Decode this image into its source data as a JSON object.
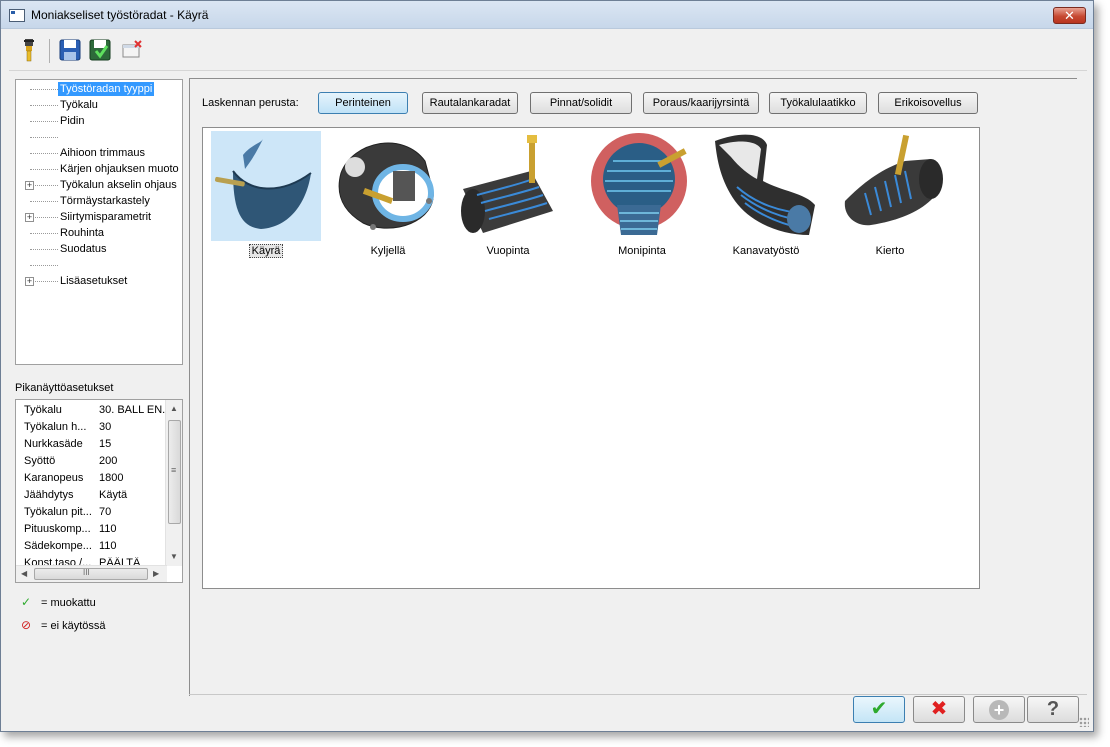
{
  "window": {
    "title": "Moniakseliset työstöradat - Käyrä",
    "close_label": "✕"
  },
  "toolbar": {
    "items": [
      {
        "icon": "tool-holder-icon"
      },
      {
        "icon": "save-icon"
      },
      {
        "icon": "save-as-icon"
      },
      {
        "icon": "delete-icon"
      }
    ]
  },
  "tree": {
    "items": [
      {
        "label": "Työstöradan tyyppi",
        "selected": true,
        "expander": false
      },
      {
        "label": "Työkalu",
        "expander": false
      },
      {
        "label": "Pidin",
        "expander": false
      },
      {
        "label": "",
        "expander": false
      },
      {
        "label": "Aihioon trimmaus",
        "expander": false
      },
      {
        "label": "Kärjen ohjauksen muoto",
        "expander": false
      },
      {
        "label": "Työkalun akselin ohjaus",
        "expander": true
      },
      {
        "label": "Törmäystarkastely",
        "expander": false
      },
      {
        "label": "Siirtymisparametrit",
        "expander": true
      },
      {
        "label": "Rouhinta",
        "expander": false
      },
      {
        "label": "Suodatus",
        "expander": false
      },
      {
        "label": "",
        "expander": false
      },
      {
        "label": "Lisäasetukset",
        "expander": true
      }
    ]
  },
  "quick_settings": {
    "title": "Pikanäyttöasetukset",
    "rows": [
      {
        "key": "Työkalu",
        "value": "30. BALL EN..."
      },
      {
        "key": "Työkalun h...",
        "value": "30"
      },
      {
        "key": "Nurkkasäde",
        "value": "15"
      },
      {
        "key": "Syöttö",
        "value": "200"
      },
      {
        "key": "Karanopeus",
        "value": "1800"
      },
      {
        "key": "Jäähdytys",
        "value": "Käytä"
      },
      {
        "key": "Työkalun pit...",
        "value": "70"
      },
      {
        "key": "Pituuskomp...",
        "value": "110"
      },
      {
        "key": "Sädekompe...",
        "value": "110"
      },
      {
        "key": "Konst.taso /...",
        "value": "PÄÄLTÄ"
      }
    ],
    "scroll_thumb_glyph": "≡",
    "hscroll_thumb_glyph": "III"
  },
  "legend": {
    "modified_icon": "✓",
    "modified_label": "= muokattu",
    "disabled_icon": "⊘",
    "disabled_label": "= ei käytössä"
  },
  "calc": {
    "label": "Laskennan perusta:",
    "buttons": [
      {
        "label": "Perinteinen",
        "active": true
      },
      {
        "label": "Rautalankaradat",
        "active": false
      },
      {
        "label": "Pinnat/solidit",
        "active": false
      },
      {
        "label": "Poraus/kaarijyrsintä",
        "active": false
      },
      {
        "label": "Työkalulaatikko",
        "active": false
      },
      {
        "label": "Erikoisovellus",
        "active": false
      }
    ]
  },
  "gallery": {
    "items": [
      {
        "label": "Käyrä",
        "selected": true,
        "icon": "curve-toolpath-icon"
      },
      {
        "label": "Kyljellä",
        "selected": false,
        "icon": "swarf-toolpath-icon"
      },
      {
        "label": "Vuopinta",
        "selected": false,
        "icon": "flowline-toolpath-icon"
      },
      {
        "label": "Monipinta",
        "selected": false,
        "icon": "multisurface-toolpath-icon"
      },
      {
        "label": "Kanavatyöstö",
        "selected": false,
        "icon": "port-machining-icon"
      },
      {
        "label": "Kierto",
        "selected": false,
        "icon": "rotary-toolpath-icon"
      }
    ]
  },
  "dialog_buttons": [
    {
      "name": "ok-button",
      "glyph": "✔",
      "color": "#2eaa2e"
    },
    {
      "name": "cancel-button",
      "glyph": "✖",
      "color": "#e02020"
    },
    {
      "name": "add-button",
      "glyph": "+",
      "color": "#aaaaaa"
    },
    {
      "name": "help-button",
      "glyph": "?",
      "color": "#555555"
    }
  ]
}
